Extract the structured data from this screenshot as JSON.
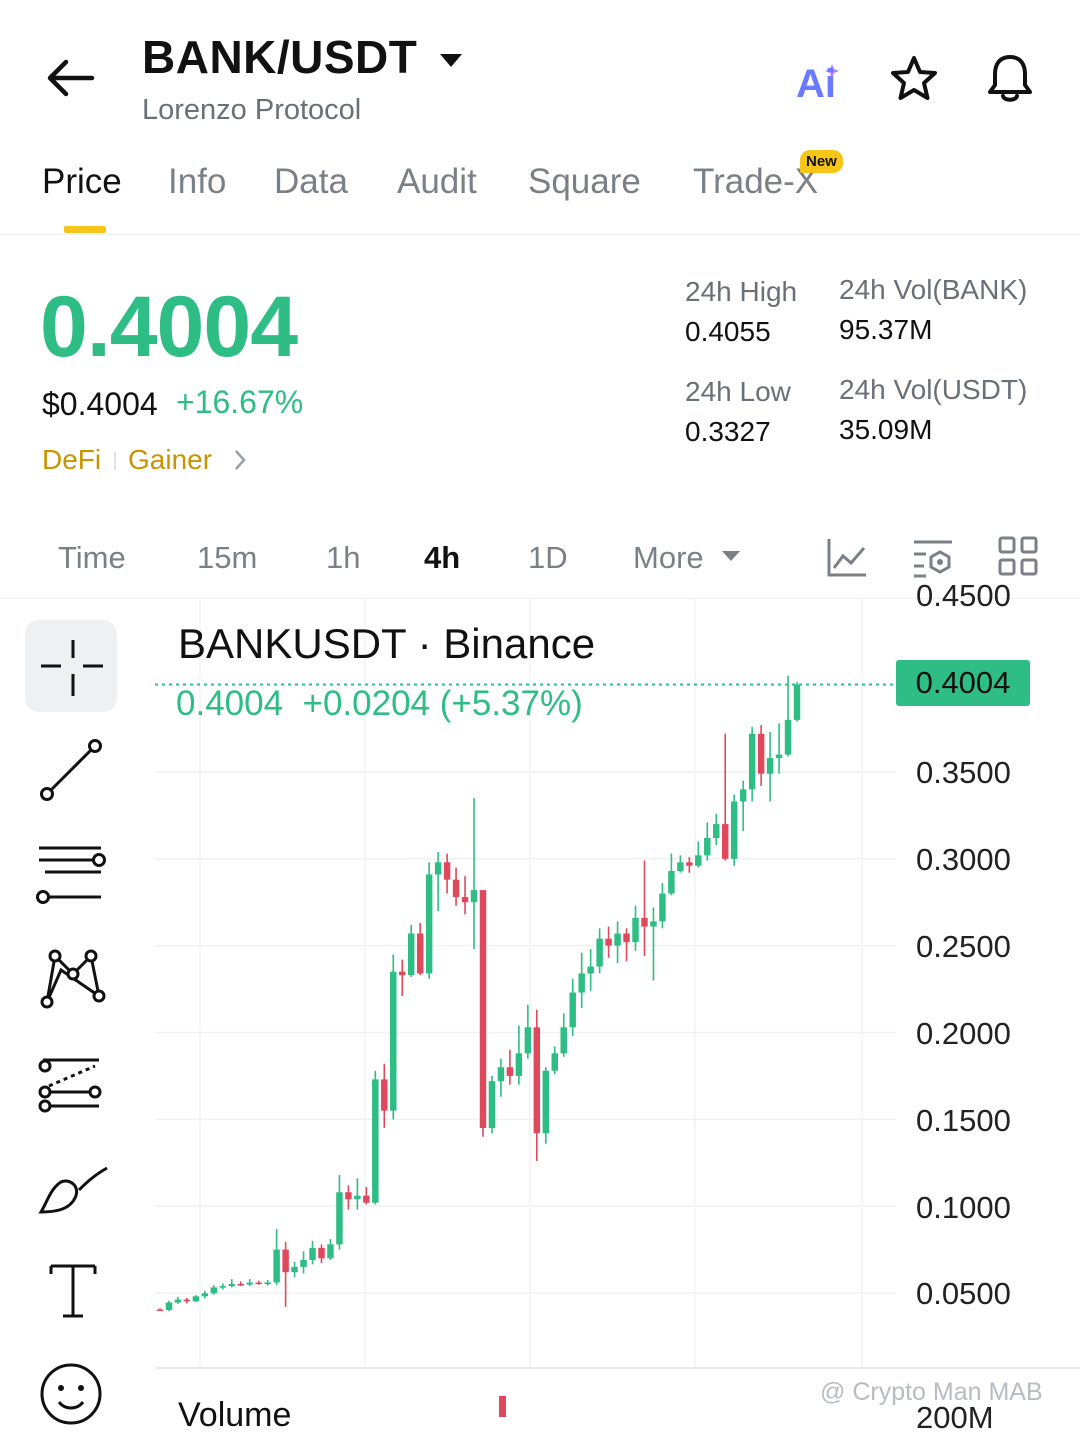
{
  "header": {
    "pair": "BANK/USDT",
    "project": "Lorenzo Protocol",
    "ai_label": "Ai"
  },
  "tabs": [
    {
      "label": "Price",
      "active": true
    },
    {
      "label": "Info"
    },
    {
      "label": "Data"
    },
    {
      "label": "Audit"
    },
    {
      "label": "Square"
    },
    {
      "label": "Trade-X",
      "badge": "New"
    }
  ],
  "ticker": {
    "price": "0.4004",
    "fiat_price": "$0.4004",
    "change": "+16.67%",
    "tags": [
      "DeFi",
      "Gainer"
    ],
    "stats": {
      "high_label": "24h High",
      "high": "0.4055",
      "low_label": "24h Low",
      "low": "0.3327",
      "vol_base_label": "24h Vol(BANK)",
      "vol_base": "95.37M",
      "vol_quote_label": "24h Vol(USDT)",
      "vol_quote": "35.09M"
    }
  },
  "intervals": [
    {
      "label": "Time"
    },
    {
      "label": "15m"
    },
    {
      "label": "1h"
    },
    {
      "label": "4h",
      "active": true
    },
    {
      "label": "1D"
    },
    {
      "label": "More"
    }
  ],
  "chart": {
    "title": "BANKUSDT · Binance",
    "ohlc_price": "0.4004",
    "ohlc_change": "+0.0204 (+5.37%)",
    "last_price_tag": "0.4004",
    "volume_label": "Volume",
    "volume_right": "200M",
    "watermark": "@ Crypto Man MAB",
    "colors": {
      "up": "#2ebd85",
      "down": "#e0495b"
    }
  },
  "chart_data": {
    "type": "candlestick",
    "title": "BANKUSDT · Binance",
    "y_ticks": [
      "0.4500",
      "0.3500",
      "0.3000",
      "0.2500",
      "0.2000",
      "0.1500",
      "0.1000",
      "0.0500"
    ],
    "ylim": [
      0.028,
      0.45
    ],
    "last_price": 0.4004,
    "candles": [
      {
        "o": 0.0405,
        "h": 0.0412,
        "l": 0.0398,
        "c": 0.0402
      },
      {
        "o": 0.0402,
        "h": 0.0455,
        "l": 0.0395,
        "c": 0.0445
      },
      {
        "o": 0.0445,
        "h": 0.0478,
        "l": 0.0438,
        "c": 0.0462
      },
      {
        "o": 0.0462,
        "h": 0.0471,
        "l": 0.044,
        "c": 0.0452
      },
      {
        "o": 0.0452,
        "h": 0.0488,
        "l": 0.0448,
        "c": 0.0481
      },
      {
        "o": 0.0481,
        "h": 0.0512,
        "l": 0.0469,
        "c": 0.0498
      },
      {
        "o": 0.0498,
        "h": 0.0545,
        "l": 0.049,
        "c": 0.0532
      },
      {
        "o": 0.0532,
        "h": 0.0555,
        "l": 0.052,
        "c": 0.054
      },
      {
        "o": 0.054,
        "h": 0.058,
        "l": 0.0532,
        "c": 0.0552
      },
      {
        "o": 0.0552,
        "h": 0.0566,
        "l": 0.054,
        "c": 0.0549
      },
      {
        "o": 0.0549,
        "h": 0.058,
        "l": 0.054,
        "c": 0.056
      },
      {
        "o": 0.056,
        "h": 0.0571,
        "l": 0.0548,
        "c": 0.0555
      },
      {
        "o": 0.0555,
        "h": 0.0575,
        "l": 0.0542,
        "c": 0.0561
      },
      {
        "o": 0.0561,
        "h": 0.0868,
        "l": 0.0545,
        "c": 0.075
      },
      {
        "o": 0.075,
        "h": 0.0795,
        "l": 0.042,
        "c": 0.062
      },
      {
        "o": 0.062,
        "h": 0.068,
        "l": 0.059,
        "c": 0.065
      },
      {
        "o": 0.065,
        "h": 0.074,
        "l": 0.0612,
        "c": 0.069
      },
      {
        "o": 0.069,
        "h": 0.08,
        "l": 0.0665,
        "c": 0.076
      },
      {
        "o": 0.076,
        "h": 0.078,
        "l": 0.0672,
        "c": 0.07
      },
      {
        "o": 0.07,
        "h": 0.081,
        "l": 0.069,
        "c": 0.078
      },
      {
        "o": 0.078,
        "h": 0.118,
        "l": 0.075,
        "c": 0.108
      },
      {
        "o": 0.108,
        "h": 0.112,
        "l": 0.098,
        "c": 0.104
      },
      {
        "o": 0.104,
        "h": 0.116,
        "l": 0.098,
        "c": 0.106
      },
      {
        "o": 0.106,
        "h": 0.111,
        "l": 0.101,
        "c": 0.102
      },
      {
        "o": 0.102,
        "h": 0.178,
        "l": 0.101,
        "c": 0.173
      },
      {
        "o": 0.173,
        "h": 0.182,
        "l": 0.145,
        "c": 0.155
      },
      {
        "o": 0.155,
        "h": 0.245,
        "l": 0.15,
        "c": 0.235
      },
      {
        "o": 0.235,
        "h": 0.242,
        "l": 0.221,
        "c": 0.233
      },
      {
        "o": 0.233,
        "h": 0.262,
        "l": 0.232,
        "c": 0.257
      },
      {
        "o": 0.257,
        "h": 0.263,
        "l": 0.233,
        "c": 0.234
      },
      {
        "o": 0.234,
        "h": 0.298,
        "l": 0.231,
        "c": 0.291
      },
      {
        "o": 0.291,
        "h": 0.304,
        "l": 0.27,
        "c": 0.298
      },
      {
        "o": 0.298,
        "h": 0.303,
        "l": 0.28,
        "c": 0.288
      },
      {
        "o": 0.288,
        "h": 0.295,
        "l": 0.273,
        "c": 0.278
      },
      {
        "o": 0.278,
        "h": 0.29,
        "l": 0.268,
        "c": 0.275
      },
      {
        "o": 0.275,
        "h": 0.335,
        "l": 0.248,
        "c": 0.282
      },
      {
        "o": 0.282,
        "h": 0.282,
        "l": 0.14,
        "c": 0.145
      },
      {
        "o": 0.145,
        "h": 0.175,
        "l": 0.142,
        "c": 0.172
      },
      {
        "o": 0.172,
        "h": 0.185,
        "l": 0.163,
        "c": 0.18
      },
      {
        "o": 0.18,
        "h": 0.19,
        "l": 0.17,
        "c": 0.175
      },
      {
        "o": 0.175,
        "h": 0.204,
        "l": 0.17,
        "c": 0.188
      },
      {
        "o": 0.188,
        "h": 0.216,
        "l": 0.185,
        "c": 0.203
      },
      {
        "o": 0.203,
        "h": 0.213,
        "l": 0.126,
        "c": 0.142
      },
      {
        "o": 0.142,
        "h": 0.18,
        "l": 0.136,
        "c": 0.178
      },
      {
        "o": 0.178,
        "h": 0.192,
        "l": 0.176,
        "c": 0.188
      },
      {
        "o": 0.188,
        "h": 0.211,
        "l": 0.186,
        "c": 0.203
      },
      {
        "o": 0.203,
        "h": 0.231,
        "l": 0.198,
        "c": 0.223
      },
      {
        "o": 0.223,
        "h": 0.246,
        "l": 0.214,
        "c": 0.234
      },
      {
        "o": 0.234,
        "h": 0.248,
        "l": 0.224,
        "c": 0.238
      },
      {
        "o": 0.238,
        "h": 0.26,
        "l": 0.234,
        "c": 0.254
      },
      {
        "o": 0.254,
        "h": 0.261,
        "l": 0.243,
        "c": 0.25
      },
      {
        "o": 0.25,
        "h": 0.264,
        "l": 0.24,
        "c": 0.257
      },
      {
        "o": 0.257,
        "h": 0.26,
        "l": 0.241,
        "c": 0.252
      },
      {
        "o": 0.252,
        "h": 0.273,
        "l": 0.247,
        "c": 0.266
      },
      {
        "o": 0.266,
        "h": 0.299,
        "l": 0.244,
        "c": 0.261
      },
      {
        "o": 0.261,
        "h": 0.272,
        "l": 0.23,
        "c": 0.264
      },
      {
        "o": 0.264,
        "h": 0.286,
        "l": 0.26,
        "c": 0.28
      },
      {
        "o": 0.28,
        "h": 0.303,
        "l": 0.279,
        "c": 0.293
      },
      {
        "o": 0.293,
        "h": 0.302,
        "l": 0.292,
        "c": 0.298
      },
      {
        "o": 0.298,
        "h": 0.301,
        "l": 0.292,
        "c": 0.296
      },
      {
        "o": 0.296,
        "h": 0.31,
        "l": 0.295,
        "c": 0.302
      },
      {
        "o": 0.302,
        "h": 0.321,
        "l": 0.299,
        "c": 0.312
      },
      {
        "o": 0.312,
        "h": 0.326,
        "l": 0.308,
        "c": 0.32
      },
      {
        "o": 0.32,
        "h": 0.372,
        "l": 0.299,
        "c": 0.3
      },
      {
        "o": 0.3,
        "h": 0.337,
        "l": 0.296,
        "c": 0.333
      },
      {
        "o": 0.333,
        "h": 0.345,
        "l": 0.316,
        "c": 0.34
      },
      {
        "o": 0.34,
        "h": 0.376,
        "l": 0.333,
        "c": 0.372
      },
      {
        "o": 0.372,
        "h": 0.377,
        "l": 0.342,
        "c": 0.349
      },
      {
        "o": 0.349,
        "h": 0.373,
        "l": 0.333,
        "c": 0.358
      },
      {
        "o": 0.358,
        "h": 0.378,
        "l": 0.349,
        "c": 0.36
      },
      {
        "o": 0.36,
        "h": 0.4055,
        "l": 0.359,
        "c": 0.38
      },
      {
        "o": 0.38,
        "h": 0.402,
        "l": 0.379,
        "c": 0.4004
      }
    ]
  }
}
